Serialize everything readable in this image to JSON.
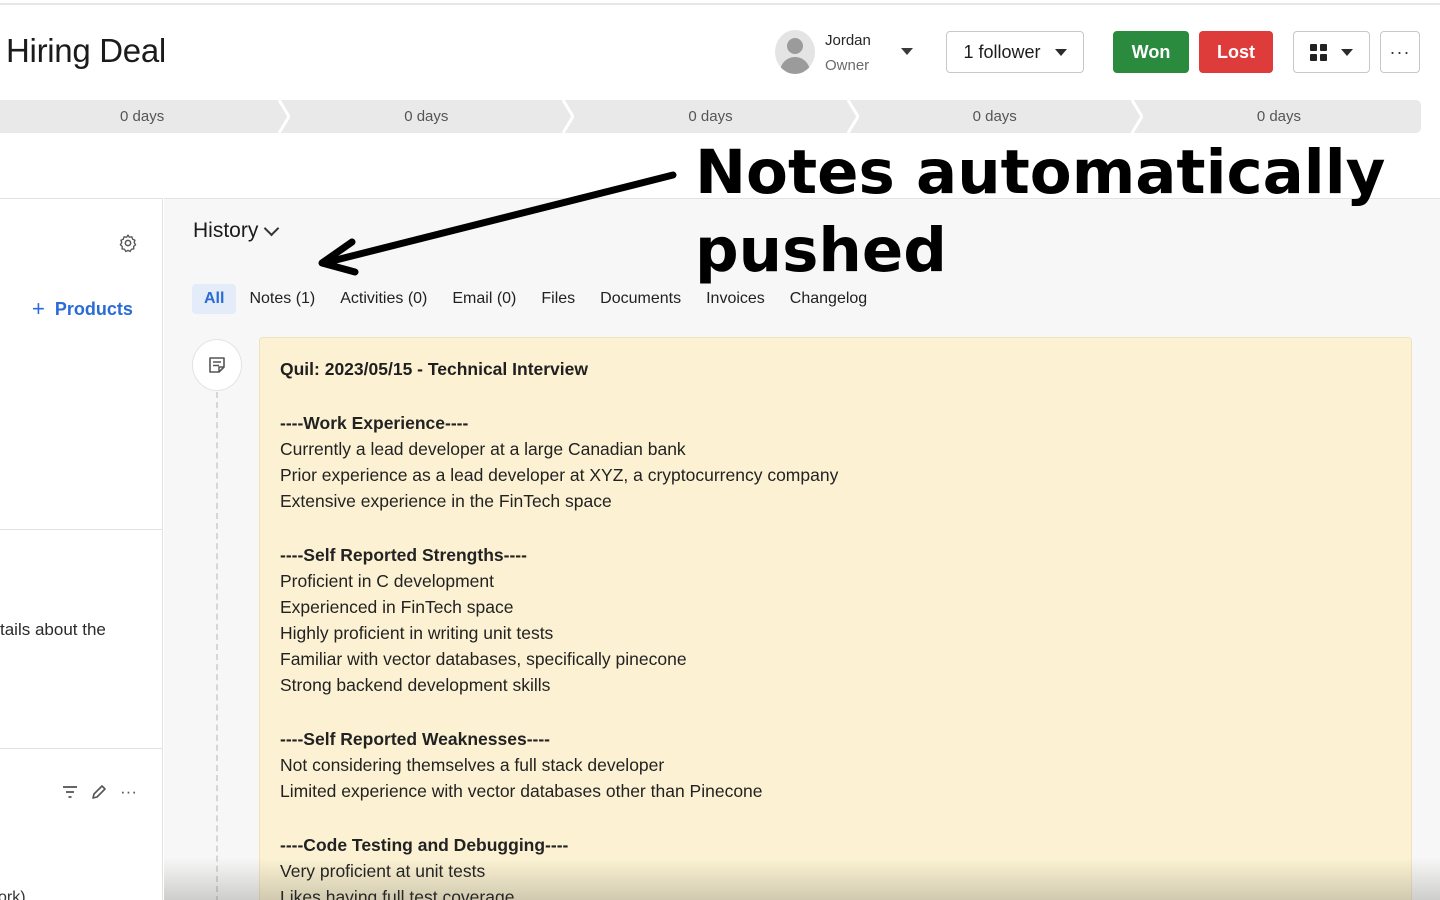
{
  "header": {
    "title": "Hiring Deal",
    "owner_name": "Jordan",
    "owner_role": "Owner",
    "follower_label": "1 follower",
    "won_label": "Won",
    "lost_label": "Lost",
    "more_label": "···",
    "won_color": "#2a8a3d",
    "lost_color": "#de3b3b"
  },
  "stages": [
    {
      "label": "0 days"
    },
    {
      "label": "0 days"
    },
    {
      "label": "0 days"
    },
    {
      "label": "0 days"
    },
    {
      "label": "0 days"
    }
  ],
  "left_panel": {
    "products_label": "Products",
    "details_text": "tails about the",
    "bottom_text": "ork)"
  },
  "history": {
    "title": "History",
    "tabs": [
      {
        "label": "All"
      },
      {
        "label": "Notes (1)"
      },
      {
        "label": "Activities (0)"
      },
      {
        "label": "Email (0)"
      },
      {
        "label": "Files"
      },
      {
        "label": "Documents"
      },
      {
        "label": "Invoices"
      },
      {
        "label": "Changelog"
      }
    ]
  },
  "note": {
    "title": "Quil: 2023/05/15 - Technical Interview",
    "sections": [
      {
        "heading": "----Work Experience----",
        "lines": [
          "Currently a lead developer at a large Canadian bank",
          "Prior experience as a lead developer at XYZ, a cryptocurrency company",
          "Extensive experience in the FinTech space"
        ]
      },
      {
        "heading": "----Self Reported Strengths----",
        "lines": [
          "Proficient in C development",
          "Experienced in FinTech space",
          "Highly proficient in writing unit tests",
          "Familiar with vector databases, specifically pinecone",
          "Strong backend development skills"
        ]
      },
      {
        "heading": "----Self Reported Weaknesses----",
        "lines": [
          "Not considering themselves a full stack developer",
          "Limited experience with vector databases other than Pinecone"
        ]
      },
      {
        "heading": "----Code Testing and Debugging----",
        "lines": [
          "Very proficient at unit tests",
          "Likes having full test coverage"
        ]
      }
    ]
  },
  "annotation": {
    "line1": "Notes automatically",
    "line2": "pushed"
  }
}
